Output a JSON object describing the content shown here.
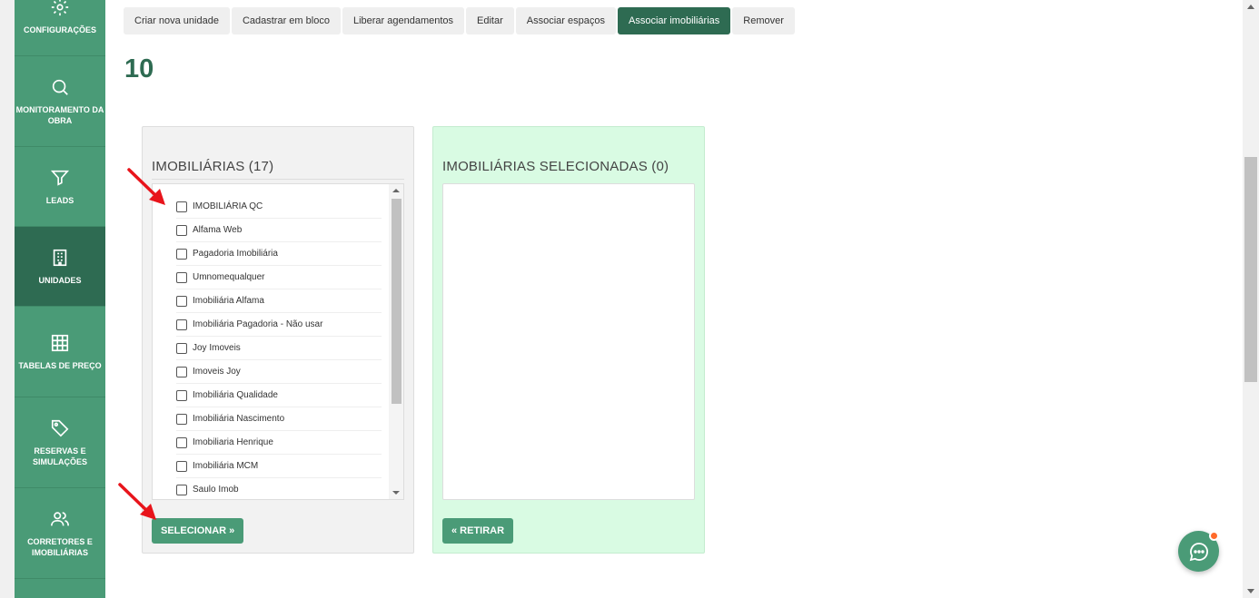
{
  "sidebar": {
    "items": [
      {
        "label": "CONFIGURAÇÕES",
        "icon": "gear-icon"
      },
      {
        "label": "MONITORAMENTO DA OBRA",
        "icon": "search-icon"
      },
      {
        "label": "LEADS",
        "icon": "funnel-icon"
      },
      {
        "label": "UNIDADES",
        "icon": "building-icon",
        "active": true
      },
      {
        "label": "TABELAS DE PREÇO",
        "icon": "grid-icon"
      },
      {
        "label": "RESERVAS E SIMULAÇÕES",
        "icon": "tag-icon"
      },
      {
        "label": "CORRETORES E IMOBILIÁRIAS",
        "icon": "users-icon"
      }
    ]
  },
  "toolbar": {
    "buttons": [
      "Criar nova unidade",
      "Cadastrar em bloco",
      "Liberar agendamentos",
      "Editar",
      "Associar espaços",
      "Associar imobiliárias",
      "Remover"
    ],
    "active": "Associar imobiliárias"
  },
  "page": {
    "title": "10"
  },
  "left_panel": {
    "title": "IMOBILIÁRIAS (17)",
    "items": [
      "IMOBILIÁRIA QC",
      "Alfama Web",
      "Pagadoria Imobiliária",
      "Umnomequalquer",
      "Imobiliária Alfama",
      "Imobiliária Pagadoria - Não usar",
      "Joy Imoveis",
      "Imoveis Joy",
      "Imobiliária Qualidade",
      "Imobiliária Nascimento",
      "Imobiliaria Henrique",
      "Imobiliária MCM",
      "Saulo Imob"
    ],
    "button": "SELECIONAR »"
  },
  "right_panel": {
    "title": "IMOBILIÁRIAS SELECIONADAS (0)",
    "button": "« RETIRAR"
  },
  "colors": {
    "sidebar": "#4a9b77",
    "sidebar_active": "#2e6b52",
    "accent": "#2e6b52",
    "selected_panel": "#d9fbe3",
    "annotation_arrow": "#e8141b",
    "notification": "#ff6b2b"
  }
}
